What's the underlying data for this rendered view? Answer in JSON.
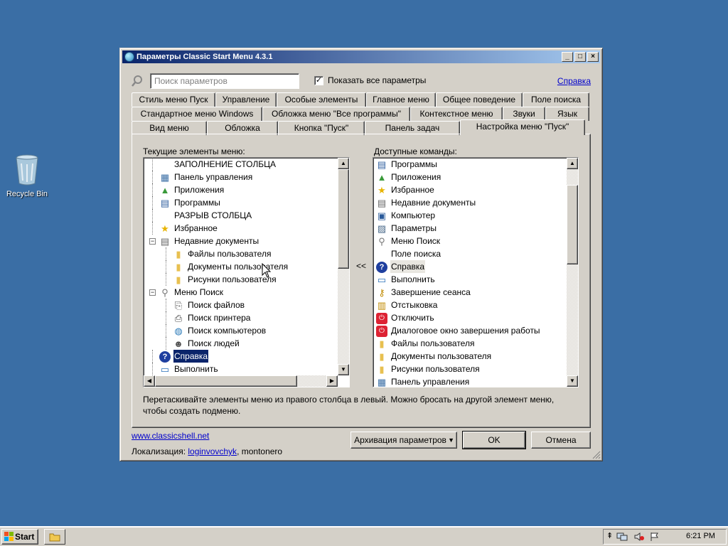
{
  "desktop": {
    "recycle_bin_label": "Recycle Bin"
  },
  "window": {
    "title": "Параметры Classic Start Menu 4.3.1",
    "controls": {
      "minimize": "_",
      "maximize": "□",
      "close": "×"
    }
  },
  "search": {
    "placeholder": "Поиск параметров",
    "show_all_label": "Показать все параметры",
    "show_all_checked": "✓"
  },
  "help_link": "Справка",
  "tabs": {
    "row1": [
      "Стиль меню Пуск",
      "Управление",
      "Особые элементы",
      "Главное меню",
      "Общее поведение",
      "Поле поиска"
    ],
    "row2": [
      "Стандартное меню Windows",
      "Обложка меню \"Все программы\"",
      "Контекстное меню",
      "Звуки",
      "Язык"
    ],
    "row3": [
      "Вид меню",
      "Обложка",
      "Кнопка \"Пуск\"",
      "Панель задач",
      "Настройка меню \"Пуск\""
    ]
  },
  "current_items": {
    "label": "Текущие элементы меню:",
    "items": [
      {
        "text": "ЗАПОЛНЕНИЕ СТОЛБЦА",
        "icon": "none-icon",
        "level": 0
      },
      {
        "text": "Панель управления",
        "icon": "control-panel-icon",
        "level": 0
      },
      {
        "text": "Приложения",
        "icon": "apps-icon",
        "level": 0
      },
      {
        "text": "Программы",
        "icon": "programs-icon",
        "level": 0
      },
      {
        "text": "РАЗРЫВ СТОЛБЦА",
        "icon": "none-icon",
        "level": 0
      },
      {
        "text": "Избранное",
        "icon": "star-icon",
        "level": 0
      },
      {
        "text": "Недавние документы",
        "icon": "documents-icon",
        "level": 0,
        "expander": "−"
      },
      {
        "text": "Файлы пользователя",
        "icon": "folder-icon",
        "level": 1
      },
      {
        "text": "Документы пользователя",
        "icon": "folder-icon",
        "level": 1
      },
      {
        "text": "Рисунки пользователя",
        "icon": "folder-icon",
        "level": 1
      },
      {
        "text": "Меню Поиск",
        "icon": "search-icon",
        "level": 0,
        "expander": "−"
      },
      {
        "text": "Поиск файлов",
        "icon": "file-search-icon",
        "level": 1
      },
      {
        "text": "Поиск принтера",
        "icon": "printer-icon",
        "level": 1
      },
      {
        "text": "Поиск компьютеров",
        "icon": "globe-icon",
        "level": 1
      },
      {
        "text": "Поиск людей",
        "icon": "people-icon",
        "level": 1
      },
      {
        "text": "Справка",
        "icon": "help-icon",
        "level": 0,
        "selected": true
      },
      {
        "text": "Выполнить",
        "icon": "run-icon",
        "level": 0
      }
    ]
  },
  "move_button": "<<",
  "available_commands": {
    "label": "Доступные команды:",
    "items": [
      {
        "text": "Программы",
        "icon": "programs-icon"
      },
      {
        "text": "Приложения",
        "icon": "apps-icon"
      },
      {
        "text": "Избранное",
        "icon": "star-icon"
      },
      {
        "text": "Недавние документы",
        "icon": "documents-icon"
      },
      {
        "text": "Компьютер",
        "icon": "computer-icon"
      },
      {
        "text": "Параметры",
        "icon": "settings-icon"
      },
      {
        "text": "Меню Поиск",
        "icon": "search-icon"
      },
      {
        "text": "Поле поиска",
        "icon": "none-icon"
      },
      {
        "text": "Справка",
        "icon": "help-icon",
        "highlighted": true
      },
      {
        "text": "Выполнить",
        "icon": "run-icon"
      },
      {
        "text": "Завершение сеанса",
        "icon": "logoff-icon"
      },
      {
        "text": "Отстыковка",
        "icon": "undock-icon"
      },
      {
        "text": "Отключить",
        "icon": "power-icon"
      },
      {
        "text": "Диалоговое окно завершения работы",
        "icon": "power-icon"
      },
      {
        "text": "Файлы пользователя",
        "icon": "folder-icon"
      },
      {
        "text": "Документы пользователя",
        "icon": "folder-icon"
      },
      {
        "text": "Рисунки пользователя",
        "icon": "folder-icon"
      },
      {
        "text": "Панель управления",
        "icon": "control-panel-icon"
      }
    ]
  },
  "hint": "Перетаскивайте элементы меню из правого столбца в левый. Можно бросать на другой элемент меню, чтобы создать подменю.",
  "footer": {
    "site_link": "www.classicshell.net",
    "localization_label": "Локализация: ",
    "localization_link": "loginvovchyk",
    "localization_rest": ", montonero",
    "backup_button": "Архивация параметров",
    "ok_button": "OK",
    "cancel_button": "Отмена"
  },
  "taskbar": {
    "start_label": "Start",
    "clock": "6:21 PM"
  },
  "colors": {
    "desktop": "#3a6ea5",
    "title_start": "#0a246a",
    "title_end": "#a6caf0",
    "selection": "#0a246a",
    "face": "#d4d0c8"
  }
}
